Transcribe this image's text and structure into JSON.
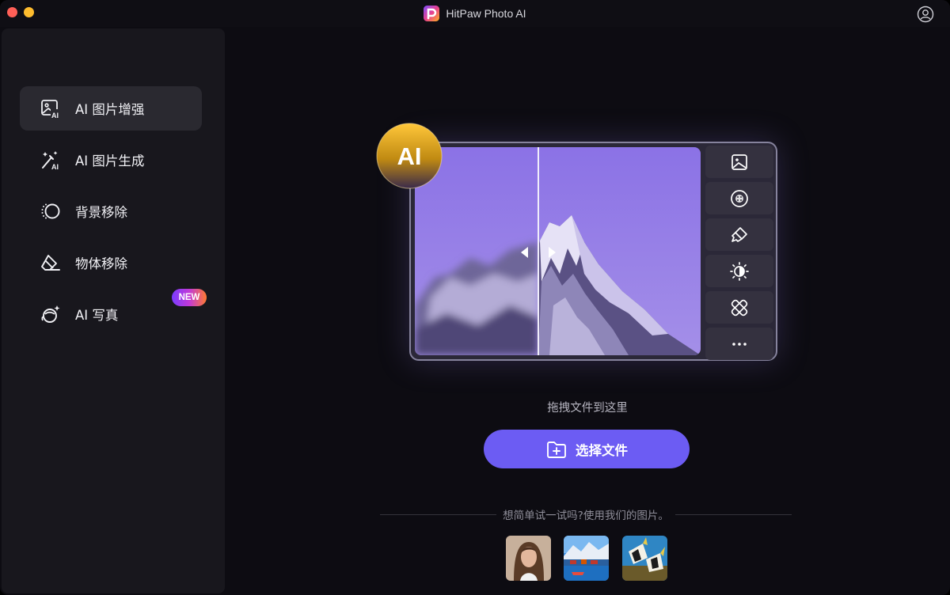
{
  "app": {
    "title": "HitPaw Photo AI"
  },
  "sidebar": {
    "items": [
      {
        "label": "AI 图片增强",
        "icon": "image-ai-icon",
        "active": true
      },
      {
        "label": "AI 图片生成",
        "icon": "magic-wand-ai-icon",
        "active": false
      },
      {
        "label": "背景移除",
        "icon": "background-remove-icon",
        "active": false
      },
      {
        "label": "物体移除",
        "icon": "eraser-icon",
        "active": false
      },
      {
        "label": "AI 写真",
        "icon": "portrait-sparkle-icon",
        "active": false,
        "badge": "NEW"
      }
    ]
  },
  "hero": {
    "ai_badge": "AI",
    "tools": [
      "image-icon",
      "denoise-icon",
      "brush-icon",
      "brightness-icon",
      "bandage-icon",
      "more-icon"
    ]
  },
  "main": {
    "drop_hint": "拖拽文件到这里",
    "choose_button": "选择文件",
    "try_text": "想简单试一试吗?使用我们的图片。",
    "samples": [
      "sample-portrait",
      "sample-harbor",
      "sample-fish"
    ]
  },
  "colors": {
    "accent": "#6c5cf3",
    "sidebar_bg": "#18171d",
    "main_bg": "#0d0c12",
    "active_item_bg": "#2a2930"
  }
}
